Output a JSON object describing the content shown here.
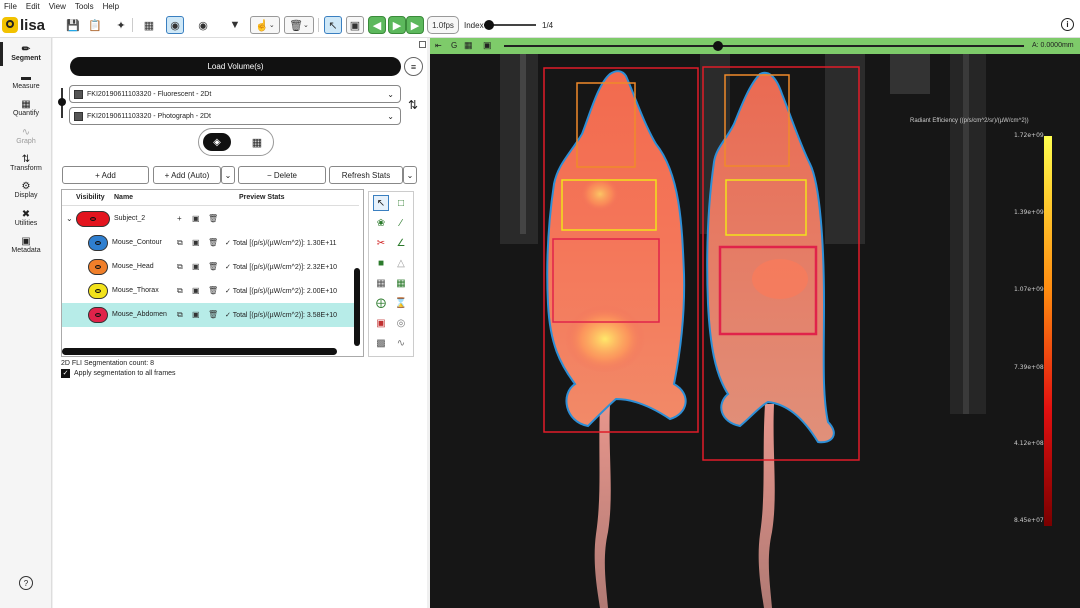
{
  "menu": [
    "File",
    "Edit",
    "View",
    "Tools",
    "Help"
  ],
  "app": {
    "name": "lisa"
  },
  "toolbar": {
    "fps_label": "1.0fps",
    "index_label": "Index",
    "frame_counter": "1/4",
    "frame_fraction": 0.0
  },
  "nav": {
    "items": [
      {
        "label": "Segment",
        "icon": "pencil-icon"
      },
      {
        "label": "Measure",
        "icon": "ruler-icon"
      },
      {
        "label": "Quantify",
        "icon": "grid-icon"
      },
      {
        "label": "Graph",
        "icon": "graph-icon"
      },
      {
        "label": "Transform",
        "icon": "transform-icon"
      },
      {
        "label": "Display",
        "icon": "gear-icon"
      },
      {
        "label": "Utilities",
        "icon": "tools-icon"
      },
      {
        "label": "Metadata",
        "icon": "image-icon"
      }
    ]
  },
  "panel": {
    "load_button": "Load Volume(s)",
    "volume_1": "FKI20190611103320 - Fluorescent - 2Dt",
    "volume_2": "FKI20190611103320 - Photograph - 2Dt",
    "add_label": "+ Add",
    "add_auto_label": "+ Add (Auto)",
    "delete_label": "− Delete",
    "refresh_label": "Refresh Stats",
    "col_visibility": "Visibility",
    "col_name": "Name",
    "col_preview": "Preview Stats",
    "subject": "Subject_2",
    "rows": [
      {
        "name": "Mouse_Contour",
        "stats": "Total [(p/s)/(µW/cm^2)]: 1.30E+11",
        "color": "#2f7fd0"
      },
      {
        "name": "Mouse_Head",
        "stats": "Total [(p/s)/(µW/cm^2)]: 2.32E+10",
        "color": "#f07f2a"
      },
      {
        "name": "Mouse_Thorax",
        "stats": "Total [(p/s)/(µW/cm^2)]: 2.00E+10",
        "color": "#f2e21b"
      },
      {
        "name": "Mouse_Abdomen",
        "stats": "Total [(p/s)/(µW/cm^2)]: 3.58E+10",
        "color": "#e0234a"
      }
    ],
    "seg_count": "2D FLI Segmentation count: 8",
    "apply_all": "Apply segmentation to all frames"
  },
  "viewer": {
    "g_label": "G",
    "readout": "A: 0.0000mm",
    "colorbar_title": "Radiant Efficiency ((p/s/cm^2/sr)/(µW/cm^2))",
    "colorbar_ticks": [
      "1.72e+09",
      "1.39e+09",
      "1.07e+09",
      "7.39e+08",
      "4.12e+08",
      "8.45e+07"
    ],
    "slider_fraction": 0.41
  }
}
